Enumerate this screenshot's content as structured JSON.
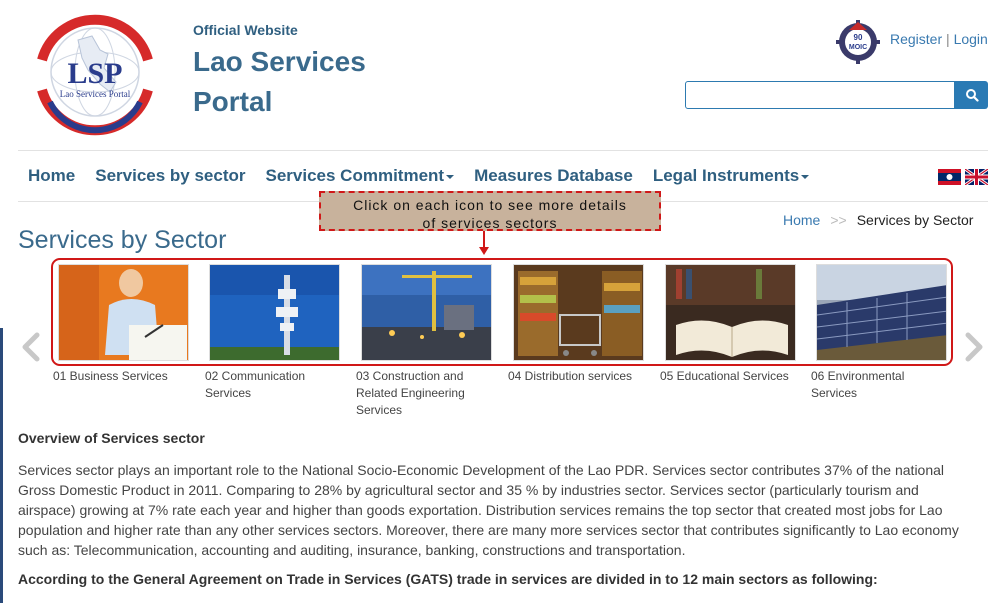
{
  "header": {
    "logo_letters": "LSP",
    "logo_caption": "Lao Services Portal",
    "official_label": "Official Website",
    "site_title": "Lao Services Portal",
    "moic_badge": "MOIC",
    "register_label": "Register",
    "auth_separator": "|",
    "login_label": "Login",
    "search_placeholder": "",
    "search_icon": "search-icon"
  },
  "nav": {
    "items": [
      {
        "label": "Home",
        "dropdown": false
      },
      {
        "label": "Services by sector",
        "dropdown": false
      },
      {
        "label": "Services Commitment",
        "dropdown": true
      },
      {
        "label": "Measures Database",
        "dropdown": false
      },
      {
        "label": "Legal Instruments",
        "dropdown": true
      }
    ],
    "languages": [
      "lao-flag",
      "uk-flag"
    ]
  },
  "callout": {
    "line1": "Click on each icon to see more details",
    "line2": "of services sectors"
  },
  "breadcrumb": {
    "home": "Home",
    "separator": ">>",
    "current": "Services by Sector"
  },
  "page_title": "Services by Sector",
  "sectors": [
    {
      "label": "01 Business Services"
    },
    {
      "label": "02 Communication Services"
    },
    {
      "label": "03 Construction and Related Engineering Services"
    },
    {
      "label": "04 Distribution services"
    },
    {
      "label": "05 Educational Services"
    },
    {
      "label": "06 Environmental Services"
    }
  ],
  "overview": {
    "title": "Overview of Services sector",
    "body": " Services sector plays an important role to the National Socio-Economic Development of the Lao PDR. Services sector contributes 37% of the national Gross Domestic Product in 2011. Comparing to 28% by agricultural sector and 35 % by industries sector. Services sector (particularly tourism and airspace) growing at 7% rate each year and higher than goods exportation. Distribution services remains the top sector that created most jobs for Lao population and higher rate than any other services sectors. Moreover, there are many more services sector that contributes significantly to Lao economy such as: Telecommunication, accounting and auditing, insurance, banking, constructions and transportation.",
    "gats": "According to the General Agreement on Trade in Services (GATS) trade in services are divided in to 12 main sectors as following:"
  },
  "colors": {
    "brand_blue": "#3a6a8c",
    "link_blue": "#3a7ab0",
    "highlight_red": "#d01818",
    "callout_bg": "#c8b29c"
  }
}
